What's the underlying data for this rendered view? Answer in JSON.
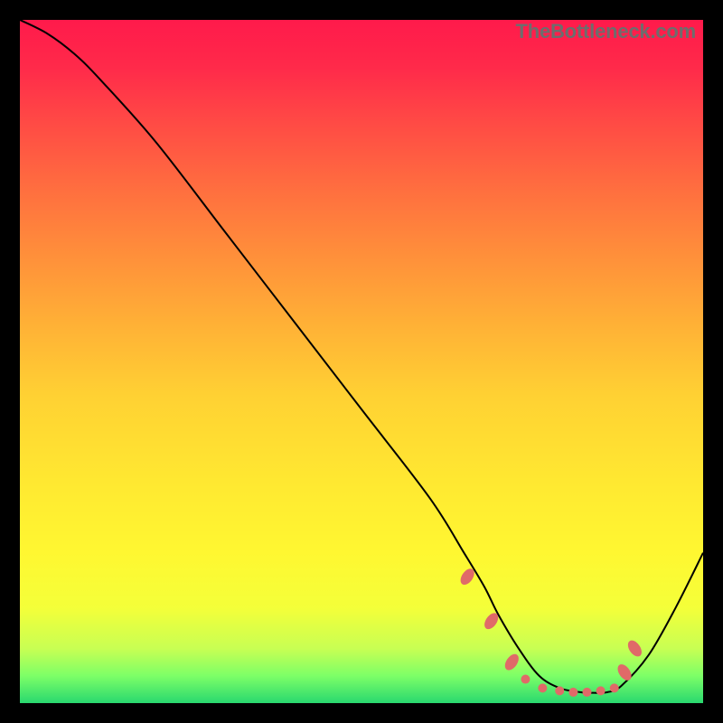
{
  "watermark": "TheBottleneck.com",
  "chart_data": {
    "type": "line",
    "title": "",
    "xlabel": "",
    "ylabel": "",
    "xlim": [
      0,
      100
    ],
    "ylim": [
      0,
      100
    ],
    "background": "gradient red→yellow→green",
    "series": [
      {
        "name": "curve",
        "x": [
          0,
          4,
          8,
          12,
          20,
          30,
          40,
          50,
          60,
          65,
          68,
          70,
          73,
          76,
          79,
          82,
          84,
          86,
          88,
          92,
          96,
          100
        ],
        "y": [
          100,
          98,
          95,
          91,
          82,
          69,
          56,
          43,
          30,
          22,
          17,
          13,
          8,
          4,
          2.2,
          1.6,
          1.5,
          1.6,
          2.5,
          7,
          14,
          22
        ]
      }
    ],
    "markers": [
      {
        "x": 65.5,
        "y": 18.5,
        "shape": "oval"
      },
      {
        "x": 69,
        "y": 12,
        "shape": "oval"
      },
      {
        "x": 72,
        "y": 6,
        "shape": "oval"
      },
      {
        "x": 74,
        "y": 3.5,
        "shape": "dot"
      },
      {
        "x": 76.5,
        "y": 2.2,
        "shape": "dot"
      },
      {
        "x": 79,
        "y": 1.8,
        "shape": "dot"
      },
      {
        "x": 81,
        "y": 1.6,
        "shape": "dot"
      },
      {
        "x": 83,
        "y": 1.6,
        "shape": "dot"
      },
      {
        "x": 85,
        "y": 1.8,
        "shape": "dot"
      },
      {
        "x": 87,
        "y": 2.2,
        "shape": "dot"
      },
      {
        "x": 88.5,
        "y": 4.5,
        "shape": "oval"
      },
      {
        "x": 90,
        "y": 8,
        "shape": "oval"
      }
    ]
  }
}
